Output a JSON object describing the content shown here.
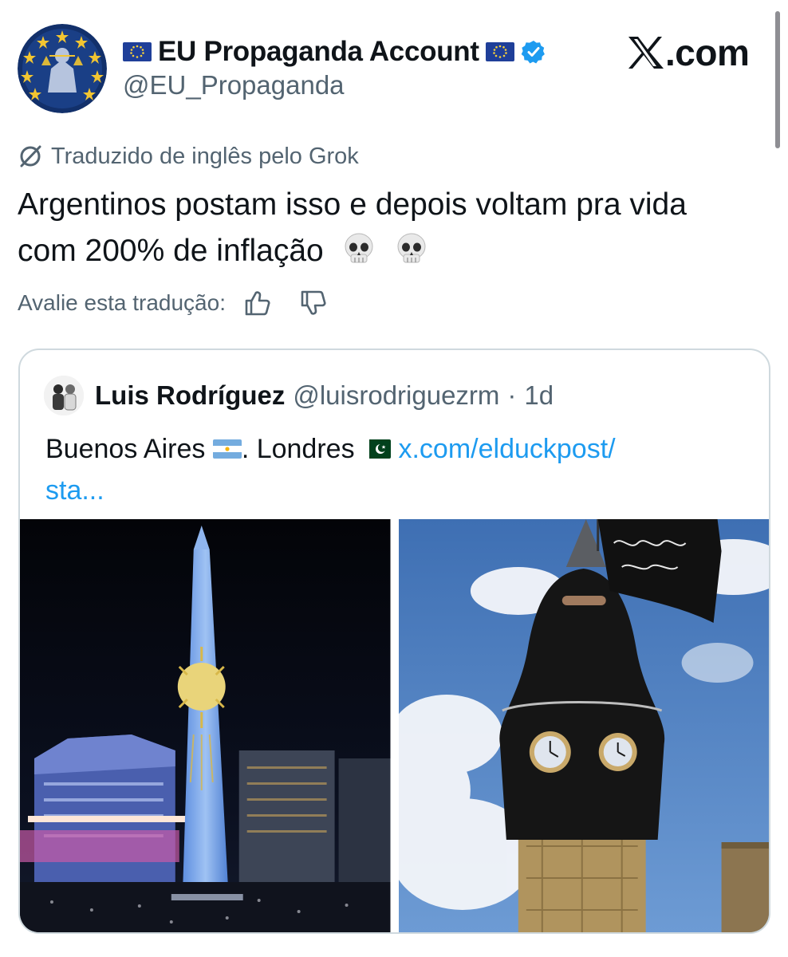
{
  "header": {
    "display_name": "EU Propaganda Account",
    "handle": "@EU_Propaganda",
    "brand": "X.com",
    "brand_suffix": ".com"
  },
  "translation": {
    "note": "Traduzido de inglês pelo Grok",
    "text_line1": "Argentinos postam isso e depois voltam pra vida",
    "text_line2": "com 200% de inflação",
    "rate_label": "Avalie esta tradução:"
  },
  "quote": {
    "name": "Luis Rodríguez",
    "handle": "@luisrodriguezrm",
    "dot": "·",
    "time": "1d",
    "text_part1": "Buenos Aires",
    "text_part2": ". Londres",
    "link_part1": "x.com/elduckpost/",
    "link_part2": "sta..."
  },
  "icons": [
    "eu-flag-icon",
    "verified-badge-icon",
    "x-logo-icon",
    "grok-slash-icon",
    "skull-emoji-icon",
    "thumbs-up-icon",
    "thumbs-down-icon",
    "argentina-flag-icon",
    "pakistan-flag-icon"
  ],
  "colors": {
    "link": "#1d9bf0",
    "secondary_text": "#536471",
    "verified": "#1d9bf0",
    "card_border": "#cfd9de"
  }
}
